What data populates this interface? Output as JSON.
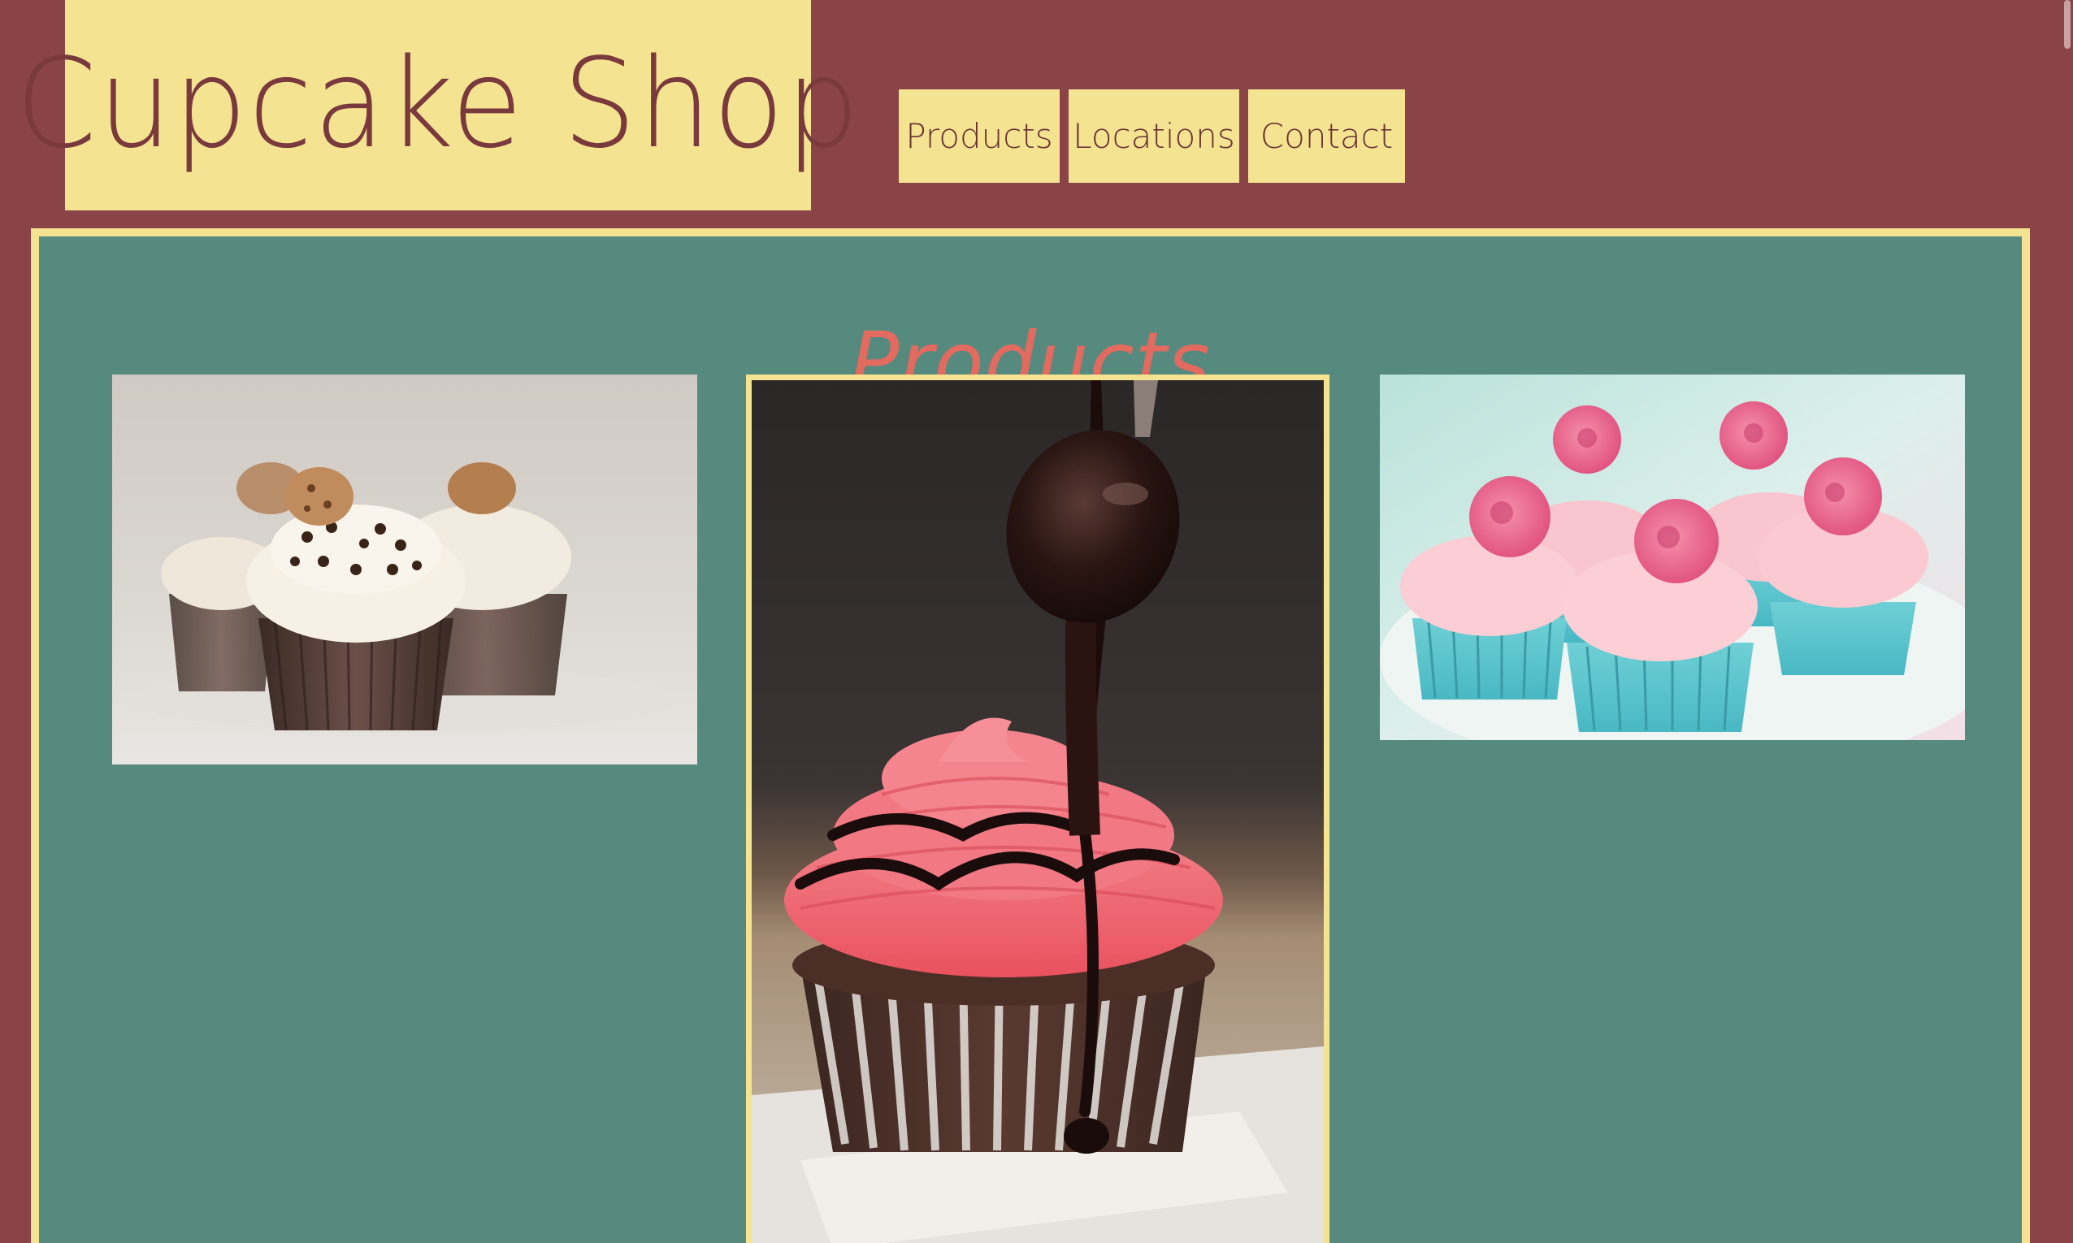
{
  "header": {
    "logo_text": "Cupcake Shop"
  },
  "nav": {
    "items": [
      {
        "label": "Products"
      },
      {
        "label": "Locations"
      },
      {
        "label": "Contact"
      }
    ]
  },
  "main": {
    "title": "Products",
    "images": [
      {
        "subject": "chocolate chip cupcakes with cookie toppers"
      },
      {
        "subject": "chocolate cupcake with pink frosting and chocolate syrup"
      },
      {
        "subject": "pink rose cupcakes"
      }
    ]
  },
  "colors": {
    "background": "#8a4448",
    "accent_yellow": "#f4e391",
    "panel_green": "#568a7e",
    "title_coral": "#e26a5e",
    "logo_text": "#7a3a3d"
  }
}
